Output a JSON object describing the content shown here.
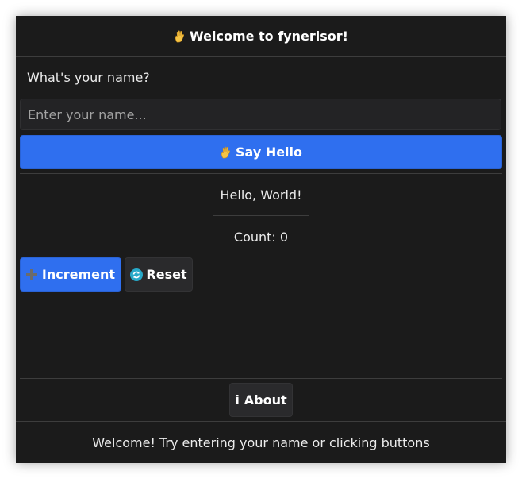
{
  "window": {
    "title": "Welcome to fynerisor!",
    "title_icon": "waving-hand-icon"
  },
  "form": {
    "prompt": "What's your name?",
    "name_value": "",
    "name_placeholder": "Enter your name...",
    "say_hello_label": "Say Hello",
    "say_hello_icon": "waving-hand-icon"
  },
  "output": {
    "greeting": "Hello, World!",
    "count_text": "Count: 0"
  },
  "counter": {
    "increment_label": "Increment",
    "increment_icon": "plus-icon",
    "reset_label": "Reset",
    "reset_icon": "refresh-icon"
  },
  "about": {
    "label": "About",
    "icon_glyph": "i"
  },
  "status": {
    "text": "Welcome! Try entering your name or clicking buttons"
  },
  "colors": {
    "background": "#1b1b1b",
    "primary": "#2f6fef",
    "secondary_button": "#2a2a2c",
    "text": "#ececec",
    "divider": "#3d3d3d"
  }
}
